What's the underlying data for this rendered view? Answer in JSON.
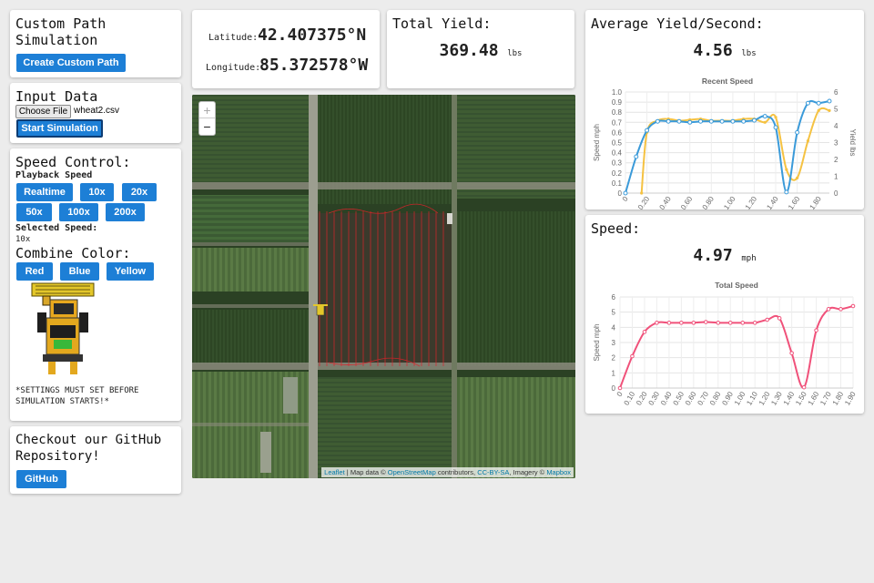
{
  "custom_path": {
    "title": "Custom Path\nSimulation",
    "button": "Create Custom Path"
  },
  "input_data": {
    "title": "Input Data",
    "choose_file": "Choose File",
    "file_name": "wheat2.csv",
    "start_button": "Start Simulation"
  },
  "speed_control": {
    "title": "Speed Control:",
    "playback_label": "Playback Speed",
    "buttons": [
      "Realtime",
      "10x",
      "20x",
      "50x",
      "100x",
      "200x"
    ],
    "selected_label": "Selected Speed:",
    "selected_value": "10x",
    "combine_title": "Combine Color:",
    "colors": [
      "Red",
      "Blue",
      "Yellow"
    ],
    "note": "*SETTINGS MUST SET BEFORE\nSIMULATION STARTS!*"
  },
  "github": {
    "title": "Checkout our GitHub\nRepository!",
    "button": "GitHub"
  },
  "coords": {
    "lat_label": "Latitude:",
    "lat_value": "42.407375°N",
    "lon_label": "Longitude:",
    "lon_value": "85.372578°W"
  },
  "total_yield": {
    "title": "Total Yield:",
    "value": "369.48",
    "unit": "lbs"
  },
  "avg_yield": {
    "title": "Average Yield/Second:",
    "value": "4.56",
    "unit": "lbs"
  },
  "speed": {
    "title": "Speed:",
    "value": "4.97",
    "unit": "mph"
  },
  "map": {
    "zoom_in": "+",
    "zoom_out": "−",
    "attr_leaflet": "Leaflet",
    "attr_text1": " | Map data © ",
    "attr_osm": "OpenStreetMap",
    "attr_text2": " contributors, ",
    "attr_cc": "CC-BY-SA",
    "attr_text3": ", Imagery © ",
    "attr_mapbox": "Mapbox"
  },
  "colors": {
    "accent": "#1d7fd6",
    "blue_series": "#3a9ad9",
    "yellow_series": "#f5c242",
    "pink_series": "#f0517a",
    "path_red": "#e0222a"
  },
  "chart_data": [
    {
      "type": "line",
      "title": "Recent Speed",
      "ylabel": "Speed mph",
      "y2label": "Yield lbs",
      "x": [
        "0",
        "0.20",
        "0.40",
        "0.60",
        "0.80",
        "1.00",
        "1.20",
        "1.40",
        "1.60",
        "1.80"
      ],
      "ylim": [
        0,
        1.0
      ],
      "y2lim": [
        0,
        6
      ],
      "yticks": [
        "0",
        "0.1",
        "0.2",
        "0.3",
        "0.4",
        "0.5",
        "0.6",
        "0.7",
        "0.8",
        "0.9",
        "1.0"
      ],
      "y2ticks": [
        "0",
        "1",
        "2",
        "3",
        "4",
        "5",
        "6"
      ],
      "series": [
        {
          "axis": "y",
          "x": [
            0,
            0.1,
            0.2,
            0.3,
            0.4,
            0.5,
            0.6,
            0.7,
            0.8,
            0.9,
            1.0,
            1.1,
            1.2,
            1.3,
            1.4,
            1.5,
            1.6,
            1.7,
            1.8,
            1.9
          ],
          "values": [
            0,
            0.36,
            0.62,
            0.71,
            0.71,
            0.71,
            0.7,
            0.71,
            0.71,
            0.71,
            0.71,
            0.71,
            0.72,
            0.76,
            0.65,
            0.01,
            0.6,
            0.89,
            0.89,
            0.91
          ]
        },
        {
          "axis": "y2",
          "x": [
            0.15,
            0.2,
            0.3,
            0.4,
            0.5,
            0.6,
            0.7,
            0.8,
            0.9,
            1.0,
            1.1,
            1.2,
            1.3,
            1.4,
            1.5,
            1.6,
            1.7,
            1.8,
            1.9
          ],
          "values": [
            0,
            3.6,
            4.3,
            4.4,
            4.3,
            4.35,
            4.4,
            4.3,
            4.3,
            4.3,
            4.4,
            4.4,
            4.2,
            4.5,
            1.4,
            0.9,
            3.1,
            4.9,
            4.9
          ]
        }
      ]
    },
    {
      "type": "line",
      "title": "Total Speed",
      "ylabel": "Speed mph",
      "x": [
        "0",
        "0.10",
        "0.20",
        "0.30",
        "0.40",
        "0.50",
        "0.60",
        "0.70",
        "0.80",
        "0.90",
        "1.00",
        "1.10",
        "1.20",
        "1.30",
        "1.40",
        "1.50",
        "1.60",
        "1.70",
        "1.80",
        "1.90"
      ],
      "ylim": [
        0,
        6
      ],
      "yticks": [
        "0",
        "1",
        "2",
        "3",
        "4",
        "5",
        "6"
      ],
      "series": [
        {
          "x": [
            0,
            0.1,
            0.2,
            0.3,
            0.4,
            0.5,
            0.6,
            0.7,
            0.8,
            0.9,
            1.0,
            1.1,
            1.2,
            1.3,
            1.4,
            1.5,
            1.6,
            1.7,
            1.8,
            1.9
          ],
          "values": [
            0,
            2.1,
            3.7,
            4.3,
            4.3,
            4.3,
            4.3,
            4.35,
            4.3,
            4.3,
            4.3,
            4.3,
            4.5,
            4.6,
            2.3,
            0.05,
            3.8,
            5.2,
            5.2,
            5.4
          ]
        }
      ]
    }
  ]
}
